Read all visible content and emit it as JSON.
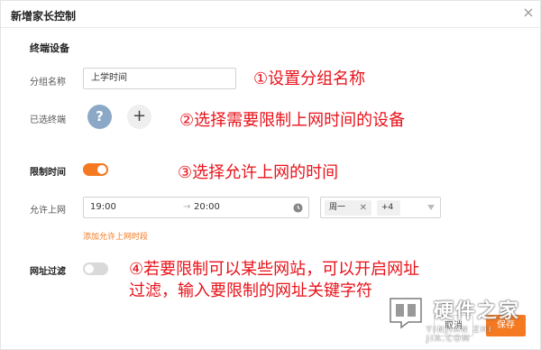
{
  "dialog": {
    "title": "新增家长控制"
  },
  "form": {
    "section_title": "终端设备",
    "group_name_label": "分组名称",
    "group_name_value": "上学时间",
    "selected_devices_label": "已选终端",
    "device_unknown_glyph": "?",
    "add_device_glyph": "+",
    "restrict_time_label": "限制时间",
    "restrict_time_enabled": true,
    "allow_online_label": "允许上网",
    "time_start": "19:00",
    "time_arrow": "→",
    "time_end": "20:00",
    "days_tag": "周一",
    "days_tag_close": "✕",
    "days_more": "+4",
    "add_period_link": "添加允许上网时段",
    "url_filter_label": "网址过滤",
    "url_filter_enabled": false
  },
  "buttons": {
    "cancel": "取消",
    "save": "保存"
  },
  "annotations": {
    "step1": "①设置分组名称",
    "step2": "②选择需要限制上网时间的设备",
    "step3": "③选择允许上网的时间",
    "step4_line1": "④若要限制可以某些网站，可以开启网址",
    "step4_line2": "过滤，输入要限制的网址关键字符"
  },
  "watermark": {
    "title": "硬件之家",
    "subtitle": "YINJIAN ZHI JIA.COM"
  },
  "colors": {
    "accent": "#f47920",
    "annotation": "#e8121a",
    "device_avatar": "#8ba9c6"
  }
}
